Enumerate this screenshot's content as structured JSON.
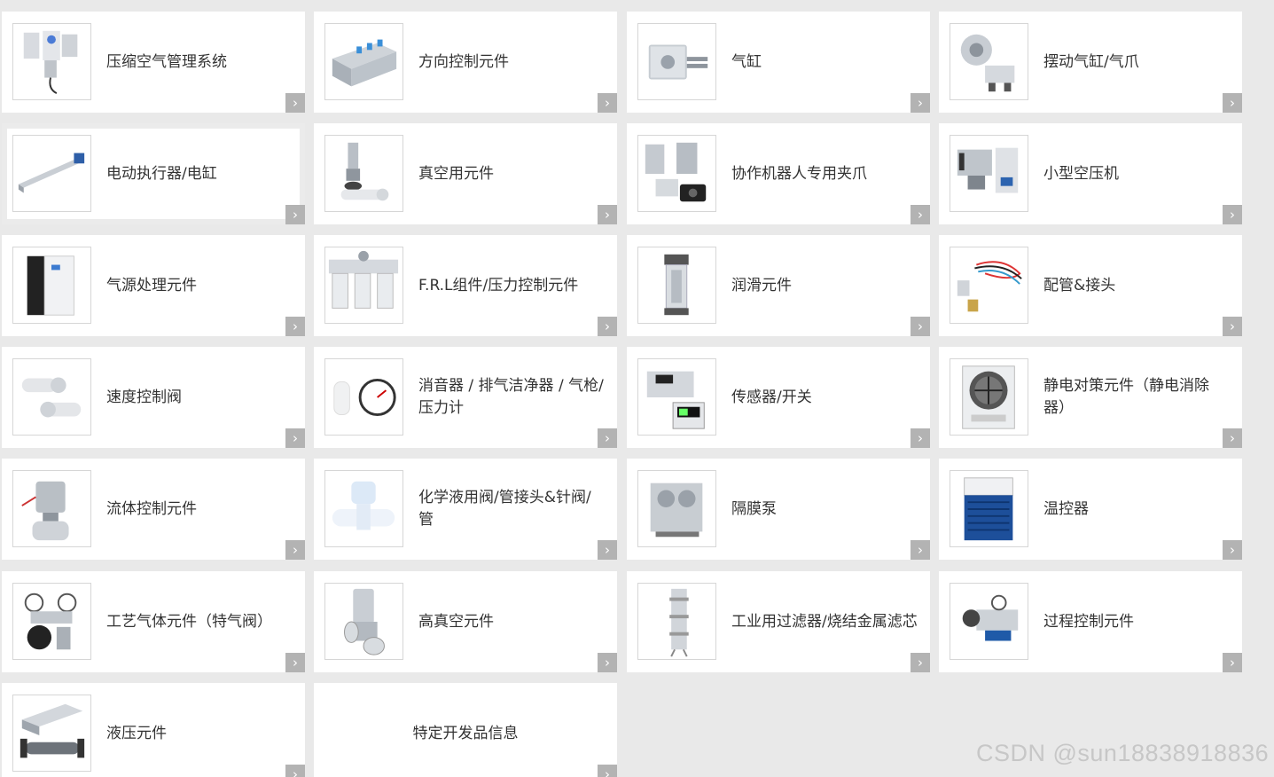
{
  "categories": [
    {
      "label": "压缩空气管理系统",
      "icon": "air-management-icon"
    },
    {
      "label": "方向控制元件",
      "icon": "valve-manifold-icon"
    },
    {
      "label": "气缸",
      "icon": "cylinder-icon"
    },
    {
      "label": "摆动气缸/气爪",
      "icon": "rotary-gripper-icon"
    },
    {
      "label": "电动执行器/电缸",
      "icon": "electric-actuator-icon"
    },
    {
      "label": "真空用元件",
      "icon": "vacuum-icon"
    },
    {
      "label": "协作机器人专用夹爪",
      "icon": "robot-gripper-icon"
    },
    {
      "label": "小型空压机",
      "icon": "compressor-icon"
    },
    {
      "label": "气源处理元件",
      "icon": "air-treatment-icon"
    },
    {
      "label": "F.R.L组件/压力控制元件",
      "icon": "frl-unit-icon"
    },
    {
      "label": "润滑元件",
      "icon": "lubricator-icon"
    },
    {
      "label": "配管&接头",
      "icon": "tubing-fitting-icon"
    },
    {
      "label": "速度控制阀",
      "icon": "speed-controller-icon"
    },
    {
      "label": "消音器 / 排气洁净器 / 气枪/压力计",
      "icon": "silencer-gauge-icon"
    },
    {
      "label": "传感器/开关",
      "icon": "sensor-switch-icon"
    },
    {
      "label": "静电对策元件（静电消除器）",
      "icon": "ionizer-icon"
    },
    {
      "label": "流体控制元件",
      "icon": "fluid-valve-icon"
    },
    {
      "label": "化学液用阀/管接头&针阀/管",
      "icon": "chemical-valve-icon"
    },
    {
      "label": "隔膜泵",
      "icon": "diaphragm-pump-icon"
    },
    {
      "label": "温控器",
      "icon": "chiller-icon"
    },
    {
      "label": "工艺气体元件（特气阀）",
      "icon": "process-gas-icon"
    },
    {
      "label": "高真空元件",
      "icon": "high-vacuum-icon"
    },
    {
      "label": "工业用过滤器/烧结金属滤芯",
      "icon": "industrial-filter-icon"
    },
    {
      "label": "过程控制元件",
      "icon": "process-control-icon"
    },
    {
      "label": "液压元件",
      "icon": "hydraulic-icon"
    },
    {
      "label": "特定开发品信息",
      "icon": ""
    }
  ],
  "arrow_glyph": "›",
  "watermark": "CSDN @sun18838918836",
  "colors": {
    "page_bg": "#e9e9e9",
    "card_bg": "#ffffff",
    "arrow_bg": "#b3b3b3",
    "text": "#333333"
  }
}
